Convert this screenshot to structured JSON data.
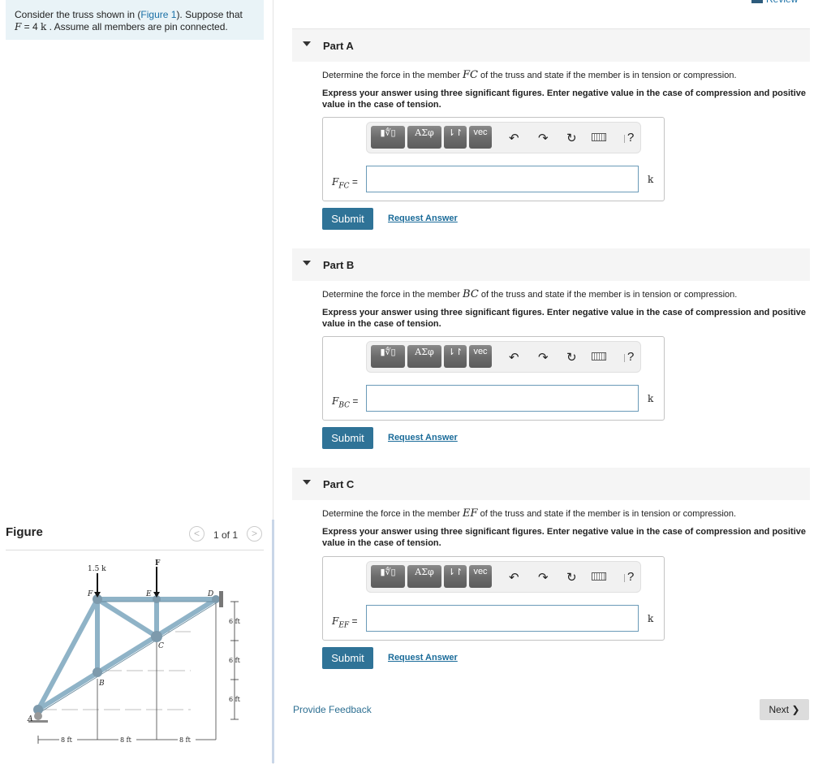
{
  "intro": {
    "prefix": "Consider the truss shown in (",
    "figure_link": "Figure 1",
    "suffix": "). Suppose that",
    "line2_var": "F",
    "line2_eq": " = 4 ",
    "line2_unit": "k",
    "line2_rest": " . Assume all members are pin connected."
  },
  "figure_panel": {
    "title": "Figure",
    "pager": "1 of 1",
    "prev_icon": "<",
    "next_icon": ">",
    "diagram": {
      "load_left": "1.5 k",
      "load_top": "F",
      "nodes": [
        "A",
        "B",
        "C",
        "D",
        "E",
        "F"
      ],
      "dims_vertical": [
        "6 ft",
        "6 ft",
        "6 ft"
      ],
      "dims_horizontal": [
        "8 ft",
        "8 ft",
        "8 ft"
      ]
    }
  },
  "header": {
    "review_label": "Review"
  },
  "parts": [
    {
      "label": "Part A",
      "q_pre": "Determine the force in the member ",
      "member": "FC",
      "q_post": " of the truss and state if the member is in tension or compression.",
      "instruction": "Express your answer using three significant figures. Enter negative value in the case of compression and positive value in the case of tension.",
      "var_main": "F",
      "var_sub": "FC",
      "equals": "=",
      "input_value": "",
      "unit": "k",
      "submit_label": "Submit",
      "request_label": "Request Answer"
    },
    {
      "label": "Part B",
      "q_pre": "Determine the force in the member ",
      "member": "BC",
      "q_post": " of the truss and state if the member is in tension or compression.",
      "instruction": "Express your answer using three significant figures. Enter negative value in the case of compression and positive value in the case of tension.",
      "var_main": "F",
      "var_sub": "BC",
      "equals": "=",
      "input_value": "",
      "unit": "k",
      "submit_label": "Submit",
      "request_label": "Request Answer"
    },
    {
      "label": "Part C",
      "q_pre": "Determine the force in the member ",
      "member": "EF",
      "q_post": " of the truss and state if the member is in tension or compression.",
      "instruction": "Express your answer using three significant figures. Enter negative value in the case of compression and positive value in the case of tension.",
      "var_main": "F",
      "var_sub": "EF",
      "equals": "=",
      "input_value": "",
      "unit": "k",
      "submit_label": "Submit",
      "request_label": "Request Answer"
    }
  ],
  "toolbar": {
    "templates_icon": "▮∜▯",
    "greek_label": "ΑΣφ",
    "arrows_label": "⇂↾",
    "vec_label": "vec",
    "undo_icon": "↶",
    "redo_icon": "↷",
    "reset_icon": "↻",
    "help_label": "?"
  },
  "footer": {
    "feedback_label": "Provide Feedback",
    "next_label": "Next ❯"
  },
  "colors": {
    "accent": "#2f7397",
    "link": "#1a70a6",
    "intro_bg": "#e9f3f7",
    "part_header_bg": "#f5f5f5"
  }
}
